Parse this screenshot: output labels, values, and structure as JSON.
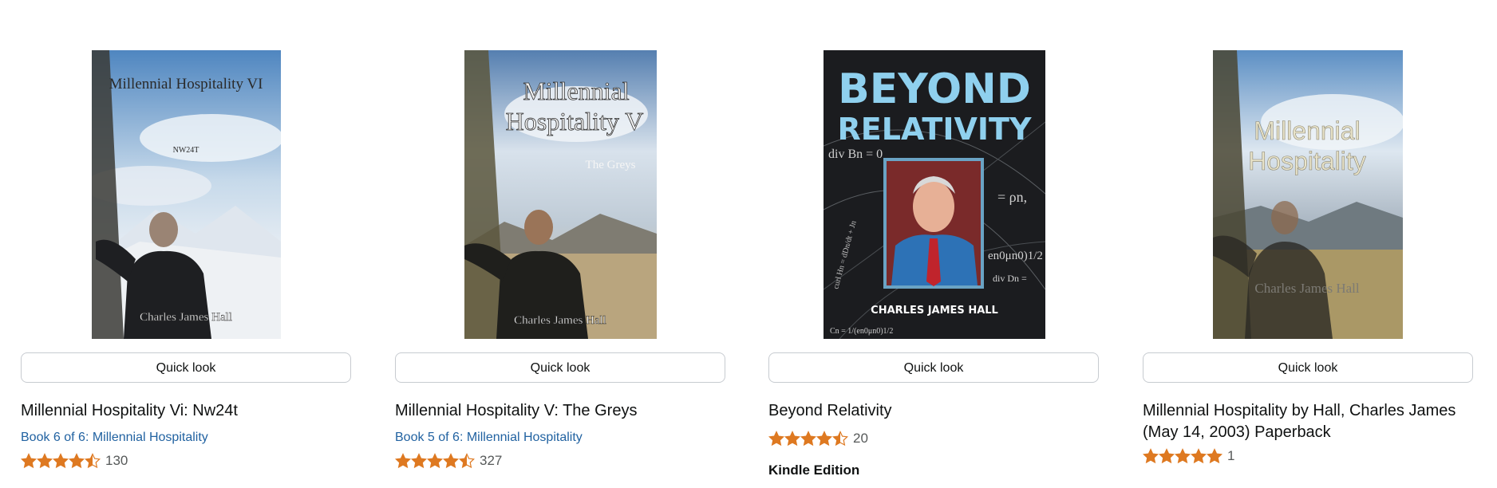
{
  "quick_look_label": "Quick look",
  "products": [
    {
      "cover": {
        "line1": "Millennial Hospitality VI",
        "line2": "NW24T",
        "author": "Charles James Hall"
      },
      "title": "Millennial Hospitality Vi: Nw24t",
      "series": "Book 6 of 6: Millennial Hospitality",
      "rating": 4.5,
      "rating_count": "130"
    },
    {
      "cover": {
        "line1": "Millennial",
        "line2": "Hospitality V",
        "line3": "The Greys",
        "author": "Charles James Hall"
      },
      "title": "Millennial Hospitality V: The Greys",
      "series": "Book 5 of 6: Millennial Hospitality",
      "rating": 4.5,
      "rating_count": "327"
    },
    {
      "cover": {
        "line1": "BEYOND",
        "line2": "RELATIVITY",
        "author": "CHARLES JAMES HALL",
        "eq1": "div Bn = 0",
        "eq2": "= ρn,",
        "eq3": "en0μn0)1/2",
        "eq4": "div Dn =",
        "eq5": "curl Hn = dDn/dt + Jn",
        "eq6": "Cn = 1/(en0μn0)1/2"
      },
      "title": "Beyond Relativity",
      "rating": 4.5,
      "rating_count": "20",
      "format": "Kindle Edition"
    },
    {
      "cover": {
        "line1": "Millennial",
        "line2": "Hospitality",
        "author": "Charles James Hall"
      },
      "title": "Millennial Hospitality by Hall, Charles James (May 14, 2003) Paperback",
      "rating": 5,
      "rating_count": "1"
    }
  ],
  "colors": {
    "star": "#de7921",
    "link": "#2162a1",
    "text": "#0f1111",
    "muted": "#565959"
  }
}
